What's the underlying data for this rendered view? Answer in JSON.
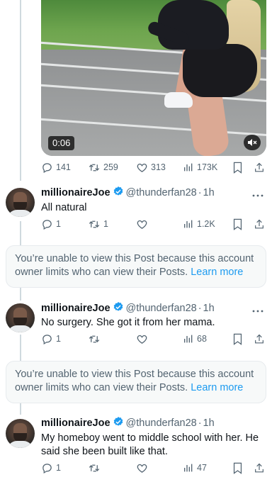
{
  "top_tweet": {
    "video": {
      "timecode": "0:06",
      "mute_icon": "muted-speaker-icon"
    },
    "stats": {
      "replies": "141",
      "reposts": "259",
      "likes": "313",
      "views": "173K"
    }
  },
  "replies": [
    {
      "name": "millionaireJoe",
      "handle": "@thunderfan28",
      "time": "1h",
      "text": "All natural",
      "stats": {
        "replies": "1",
        "reposts": "1",
        "likes": "",
        "views": "1.2K"
      }
    },
    {
      "name": "millionaireJoe",
      "handle": "@thunderfan28",
      "time": "1h",
      "text": "No surgery. She got it from her mama.",
      "stats": {
        "replies": "1",
        "reposts": "",
        "likes": "",
        "views": "68"
      }
    },
    {
      "name": "millionaireJoe",
      "handle": "@thunderfan28",
      "time": "1h",
      "text": "My homeboy went to middle school with her. He said she been built like that.",
      "stats": {
        "replies": "1",
        "reposts": "",
        "likes": "",
        "views": "47"
      }
    }
  ],
  "notice": {
    "text": "You’re unable to view this Post because this account owner limits who can view their Posts.",
    "link": "Learn more"
  },
  "dot": "·",
  "colors": {
    "verified": "#1d9bf0",
    "link": "#1d9bf0",
    "secondary_text": "#536471"
  }
}
